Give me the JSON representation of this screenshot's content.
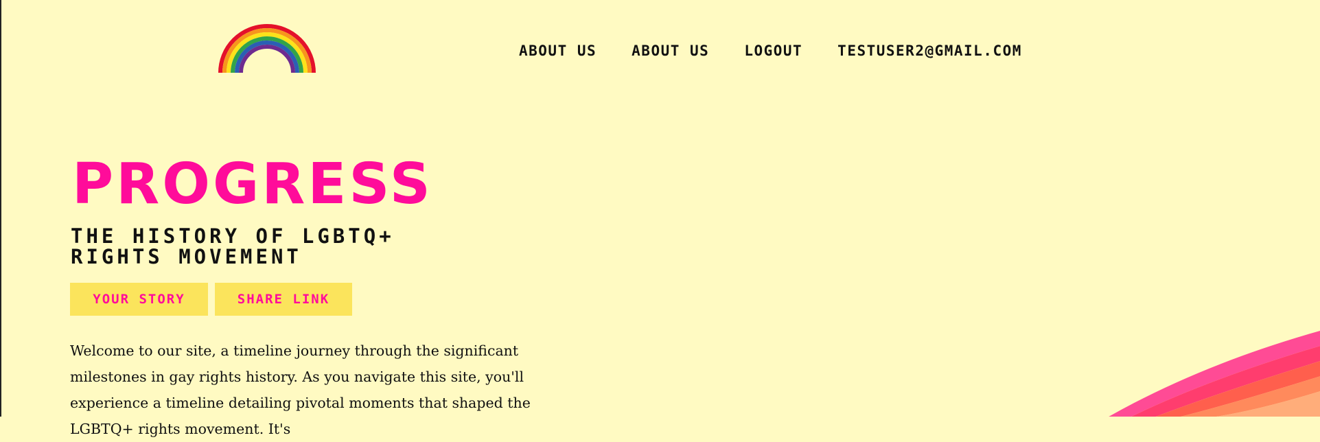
{
  "header": {
    "logo": {
      "icon": "rainbow-icon"
    },
    "nav": [
      {
        "label": "ABOUT US"
      },
      {
        "label": "ABOUT US"
      },
      {
        "label": "LOGOUT"
      },
      {
        "label": "TESTUSER2@GMAIL.COM"
      }
    ]
  },
  "hero": {
    "title": "PROGRESS",
    "subtitle_line1": "THE HISTORY OF LGBTQ+",
    "subtitle_line2": "RIGHTS MOVEMENT",
    "buttons": [
      {
        "label": "YOUR STORY"
      },
      {
        "label": "SHARE LINK"
      }
    ],
    "intro_text": "Welcome to our site, a timeline journey through the significant milestones in gay rights history. As you navigate this site, you'll experience a timeline detailing pivotal moments that shaped the LGBTQ+ rights movement. It's"
  },
  "colors": {
    "background": "#fffac2",
    "accent_pink": "#ff0c9a",
    "button_yellow": "#fbe45c",
    "text": "#111111"
  }
}
